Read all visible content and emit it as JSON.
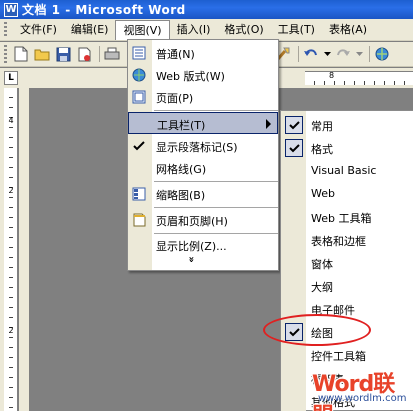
{
  "window": {
    "title": "文档 1 - Microsoft Word",
    "app_icon": "W"
  },
  "menubar": {
    "items": [
      {
        "label": "文件(F)"
      },
      {
        "label": "编辑(E)"
      },
      {
        "label": "视图(V)"
      },
      {
        "label": "插入(I)"
      },
      {
        "label": "格式(O)"
      },
      {
        "label": "工具(T)"
      },
      {
        "label": "表格(A)"
      }
    ]
  },
  "ruler": {
    "corner_label": "L",
    "h_numbers": [
      "8"
    ],
    "v_numbers": [
      "4",
      "2",
      "2"
    ]
  },
  "view_menu": {
    "items": [
      {
        "label": "普通(N)",
        "icon": "normal-view-icon"
      },
      {
        "label": "Web 版式(W)",
        "icon": "web-layout-icon"
      },
      {
        "label": "页面(P)",
        "icon": "page-layout-icon"
      },
      {
        "label": "工具栏(T)",
        "icon": "",
        "highlighted": true,
        "submenu": true
      },
      {
        "label": "显示段落标记(S)",
        "icon": "check-icon"
      },
      {
        "label": "网格线(G)",
        "icon": ""
      },
      {
        "label": "缩略图(B)",
        "icon": "thumbnails-icon"
      },
      {
        "label": "页眉和页脚(H)",
        "icon": "header-footer-icon"
      },
      {
        "label": "显示比例(Z)...",
        "icon": ""
      }
    ],
    "expand_glyph": "»"
  },
  "toolbars_submenu": {
    "items": [
      {
        "label": "常用",
        "checked": true
      },
      {
        "label": "格式",
        "checked": true
      },
      {
        "label": "Visual Basic",
        "checked": false
      },
      {
        "label": "Web",
        "checked": false
      },
      {
        "label": "Web 工具箱",
        "checked": false
      },
      {
        "label": "表格和边框",
        "checked": false
      },
      {
        "label": "窗体",
        "checked": false
      },
      {
        "label": "大纲",
        "checked": false
      },
      {
        "label": "电子邮件",
        "checked": false
      },
      {
        "label": "绘图",
        "checked": true
      },
      {
        "label": "控件工具箱",
        "checked": false
      },
      {
        "label": "框架集",
        "checked": false
      },
      {
        "label": "其他格式",
        "checked": false
      }
    ]
  },
  "watermark": {
    "logo": "Word联盟",
    "url": "www.wordlm.com"
  },
  "colors": {
    "titlebar": "#1d5fd0",
    "menu_highlight": "#b6bdd2",
    "annotation": "#e02020",
    "watermark_red": "#e8432a",
    "watermark_blue": "#2a4e9a"
  }
}
